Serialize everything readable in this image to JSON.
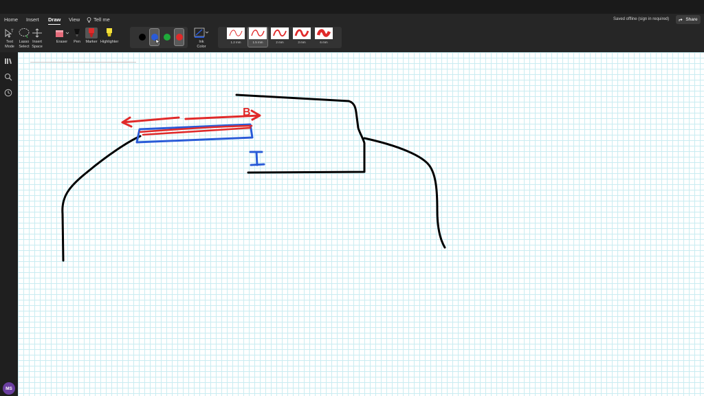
{
  "menu": {
    "items": [
      {
        "label": "Home",
        "active": false
      },
      {
        "label": "Insert",
        "active": false
      },
      {
        "label": "Draw",
        "active": true
      },
      {
        "label": "View",
        "active": false
      }
    ],
    "tell_me": "Tell me"
  },
  "status": "Saved offline (sign in required)",
  "share_label": "Share",
  "tools": {
    "text_mode": "Text\nMode",
    "lasso_select": "Lasso\nSelect",
    "insert_space": "Insert\nSpace",
    "eraser": "Eraser",
    "pen": "Pen",
    "marker": "Marker",
    "highlighter": "Highlighter",
    "ink_color": "Ink\nColor"
  },
  "swatches": [
    {
      "color": "#000000",
      "selected": false
    },
    {
      "color": "#2a5bd7",
      "selected": true
    },
    {
      "color": "#1faa3a",
      "selected": false
    },
    {
      "color": "#e02a2a",
      "selected": false
    }
  ],
  "thickness": [
    {
      "label": "1.2 mm",
      "selected": false
    },
    {
      "label": "1.5 mm",
      "selected": true
    },
    {
      "label": "2 mm",
      "selected": false
    },
    {
      "label": "3 mm",
      "selected": false
    },
    {
      "label": "6 mm",
      "selected": false
    }
  ],
  "user_initials": "MS",
  "ink_labels": {
    "letter_b": "B",
    "letter_i": "I"
  },
  "colors": {
    "ink_black": "#000000",
    "ink_red": "#e02a2a",
    "ink_blue": "#2a5bd7",
    "grid": "#c9ecf1"
  }
}
